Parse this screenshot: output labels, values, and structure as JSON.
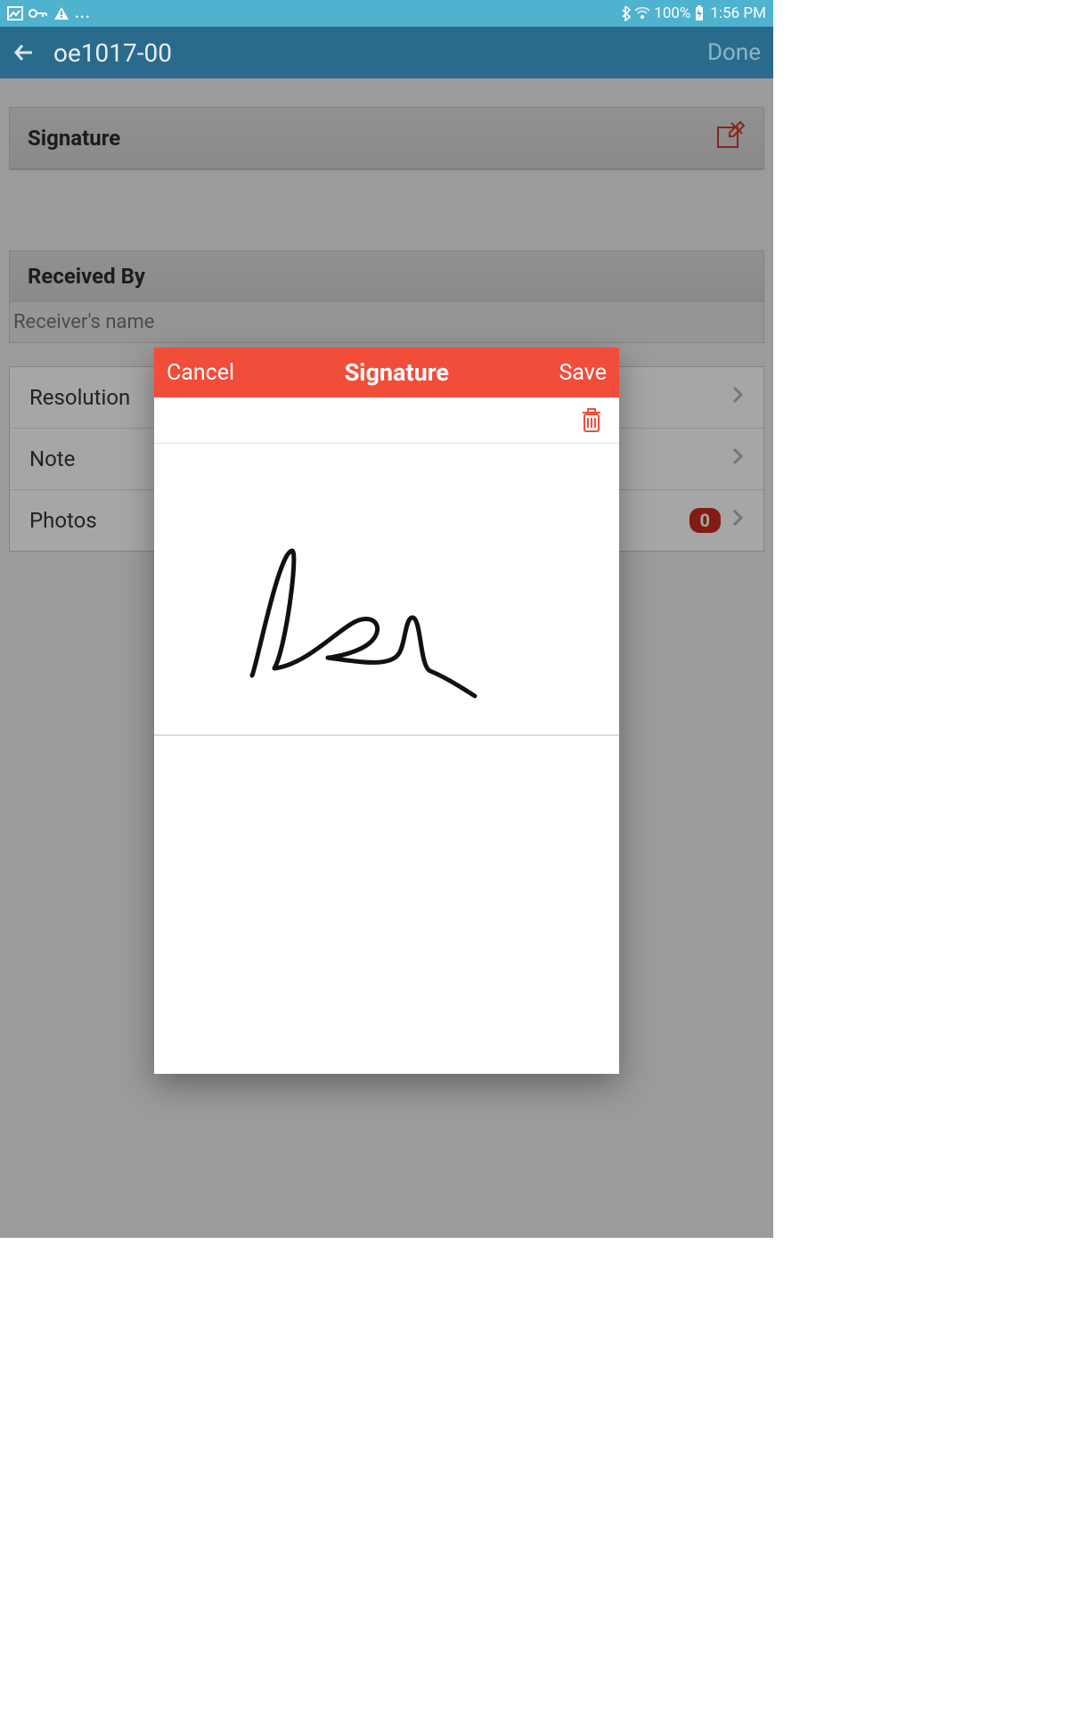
{
  "statusbar": {
    "dots": "...",
    "battery_pct": "100%",
    "time": "1:56 PM"
  },
  "header": {
    "title": "oe1017-00",
    "done_label": "Done"
  },
  "page": {
    "signature_label": "Signature",
    "received_by_label": "Received By",
    "receiver_placeholder": "Receiver's name",
    "rows": {
      "resolution": "Resolution",
      "note": "Note",
      "photos": "Photos",
      "photos_count": "0"
    }
  },
  "modal": {
    "cancel": "Cancel",
    "title": "Signature",
    "save": "Save"
  }
}
